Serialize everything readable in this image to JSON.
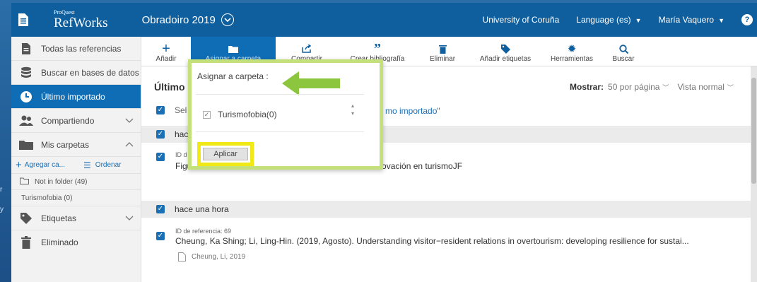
{
  "header": {
    "brand_small": "ProQuest",
    "brand_big": "RefWorks",
    "project": "Obradoiro 2019",
    "university": "University of Coruña",
    "language": "Language (es)",
    "user": "María Vaquero",
    "help": "?"
  },
  "toolbar": {
    "items": [
      {
        "label": "Añadir",
        "icon": "plus-icon"
      },
      {
        "label": "Asignar a carpeta",
        "icon": "folder-icon"
      },
      {
        "label": "Compartir",
        "icon": "share-icon"
      },
      {
        "label": "Crear bibliografía",
        "icon": "quote-icon"
      },
      {
        "label": "Eliminar",
        "icon": "trash-icon"
      },
      {
        "label": "Añadir etiquetas",
        "icon": "tag-icon"
      },
      {
        "label": "Herramientas",
        "icon": "gear-icon"
      },
      {
        "label": "Buscar",
        "icon": "search-icon"
      }
    ]
  },
  "sidebar": {
    "items": [
      {
        "label": "Todas las referencias",
        "icon": "document-icon"
      },
      {
        "label": "Buscar en bases de datos",
        "icon": "database-icon"
      },
      {
        "label": "Último importado",
        "icon": "clock-icon"
      },
      {
        "label": "Compartiendo",
        "icon": "users-icon"
      },
      {
        "label": "Mis carpetas",
        "icon": "folder-icon"
      },
      {
        "label": "Etiquetas",
        "icon": "tag-icon"
      },
      {
        "label": "Eliminado",
        "icon": "trash-icon"
      }
    ],
    "add_folder": "Agregar ca...",
    "sort": "Ordenar",
    "folders": [
      "Not in folder (49)",
      "Turismofobia (0)"
    ]
  },
  "main": {
    "heading": "Último",
    "select_prefix": "Sel",
    "select_suffix": "mo importado\"",
    "show_label": "Mostrar:",
    "per_page": "50 por página",
    "view": "Vista normal",
    "group1_label": "hac",
    "ref1_id": "ID d",
    "ref1_title_start": "Figu",
    "ref1_title_end": "innovación en turismoJF",
    "group2_label": "hace una hora",
    "ref2_id": "ID de referencia: 69",
    "ref2_title": "Cheung, Ka Shing; Li, Ling-Hin. (2019, Agosto). Understanding visitor−resident relations in overtourism: developing resilience for sustai...",
    "ref2_attachment": "Cheung, Li, 2019"
  },
  "popover": {
    "title": "Asignar a carpeta :",
    "folder_label": "Turismofobia(0)",
    "apply": "Aplicar"
  },
  "colors": {
    "brand_blue": "#0f5f9e",
    "active_blue": "#0f6db5",
    "highlight_green": "#c4e07a",
    "highlight_yellow": "#f0e916",
    "arrow_green": "#8cc63f"
  }
}
